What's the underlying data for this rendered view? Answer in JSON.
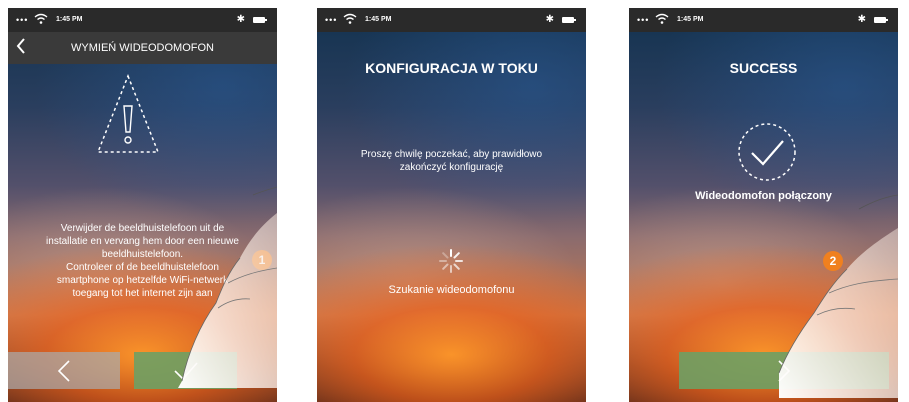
{
  "status_bar": {
    "time": "1:45 PM"
  },
  "screen1": {
    "header_title": "WYMIEŃ WIDEODOMOFON",
    "message_lines": [
      "Verwijder de beeldhuistelefoon uit de",
      "installatie en vervang hem door een nieuwe",
      "beeldhuistelefoon.",
      "Controleer of de beeldhuistelefoon",
      "smartphone op hetzelfde WiFi-netwerk",
      "toegang tot het internet zijn aan"
    ],
    "step_badge": "1"
  },
  "screen2": {
    "title": "KONFIGURACJA W TOKU",
    "message_lines": [
      "Proszę chwilę poczekać, aby prawidłowo",
      "zakończyć konfigurację"
    ],
    "status": "Szukanie wideodomofonu"
  },
  "screen3": {
    "title": "SUCCESS",
    "message": "Wideodomofon połączony",
    "step_badge": "2"
  },
  "icons": {
    "warning": "warning-triangle-icon",
    "check": "check-icon",
    "chevron_left": "chevron-left-icon",
    "chevron_right": "chevron-right-icon",
    "spinner": "spinner-icon",
    "success": "check-circle-icon"
  },
  "colors": {
    "confirm_button": "#6ea064",
    "back_button": "#aaaaaa",
    "badge": "#f0801f",
    "header_bar": "#3a3a3a"
  }
}
